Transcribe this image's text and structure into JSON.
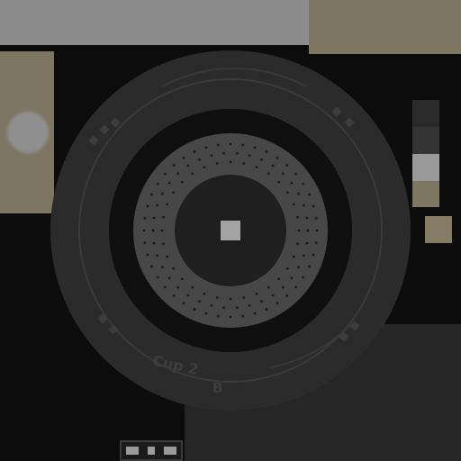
{
  "colors": {
    "background": "#0c0c0c",
    "top_bar": "#8c8c8c",
    "khaki": "#7d7663",
    "khaki_light": "#837b64",
    "tire_outer": "#2b2b2b",
    "tire_inner_ring": "#474747",
    "hub": "#1f1f1f",
    "center_square": "#a3a3a3",
    "light_grey_blob": "#8f8f8f"
  },
  "tire": {
    "sidewall_text_top": "",
    "sidewall_text_left": "",
    "sidewall_text_right": "",
    "sidewall_text_bottom": "Cup 2",
    "sidewall_badge": "B"
  },
  "side_strip": {
    "segments": [
      "#2a2a2a",
      "#343434",
      "#9a9a9a",
      "#7d7663"
    ]
  }
}
